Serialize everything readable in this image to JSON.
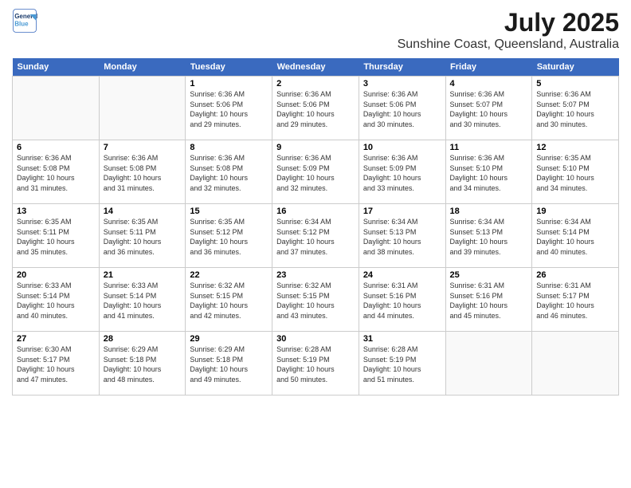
{
  "header": {
    "logo_line1": "General",
    "logo_line2": "Blue",
    "title": "July 2025",
    "subtitle": "Sunshine Coast, Queensland, Australia"
  },
  "days_of_week": [
    "Sunday",
    "Monday",
    "Tuesday",
    "Wednesday",
    "Thursday",
    "Friday",
    "Saturday"
  ],
  "weeks": [
    [
      {
        "num": "",
        "info": ""
      },
      {
        "num": "",
        "info": ""
      },
      {
        "num": "1",
        "info": "Sunrise: 6:36 AM\nSunset: 5:06 PM\nDaylight: 10 hours\nand 29 minutes."
      },
      {
        "num": "2",
        "info": "Sunrise: 6:36 AM\nSunset: 5:06 PM\nDaylight: 10 hours\nand 29 minutes."
      },
      {
        "num": "3",
        "info": "Sunrise: 6:36 AM\nSunset: 5:06 PM\nDaylight: 10 hours\nand 30 minutes."
      },
      {
        "num": "4",
        "info": "Sunrise: 6:36 AM\nSunset: 5:07 PM\nDaylight: 10 hours\nand 30 minutes."
      },
      {
        "num": "5",
        "info": "Sunrise: 6:36 AM\nSunset: 5:07 PM\nDaylight: 10 hours\nand 30 minutes."
      }
    ],
    [
      {
        "num": "6",
        "info": "Sunrise: 6:36 AM\nSunset: 5:08 PM\nDaylight: 10 hours\nand 31 minutes."
      },
      {
        "num": "7",
        "info": "Sunrise: 6:36 AM\nSunset: 5:08 PM\nDaylight: 10 hours\nand 31 minutes."
      },
      {
        "num": "8",
        "info": "Sunrise: 6:36 AM\nSunset: 5:08 PM\nDaylight: 10 hours\nand 32 minutes."
      },
      {
        "num": "9",
        "info": "Sunrise: 6:36 AM\nSunset: 5:09 PM\nDaylight: 10 hours\nand 32 minutes."
      },
      {
        "num": "10",
        "info": "Sunrise: 6:36 AM\nSunset: 5:09 PM\nDaylight: 10 hours\nand 33 minutes."
      },
      {
        "num": "11",
        "info": "Sunrise: 6:36 AM\nSunset: 5:10 PM\nDaylight: 10 hours\nand 34 minutes."
      },
      {
        "num": "12",
        "info": "Sunrise: 6:35 AM\nSunset: 5:10 PM\nDaylight: 10 hours\nand 34 minutes."
      }
    ],
    [
      {
        "num": "13",
        "info": "Sunrise: 6:35 AM\nSunset: 5:11 PM\nDaylight: 10 hours\nand 35 minutes."
      },
      {
        "num": "14",
        "info": "Sunrise: 6:35 AM\nSunset: 5:11 PM\nDaylight: 10 hours\nand 36 minutes."
      },
      {
        "num": "15",
        "info": "Sunrise: 6:35 AM\nSunset: 5:12 PM\nDaylight: 10 hours\nand 36 minutes."
      },
      {
        "num": "16",
        "info": "Sunrise: 6:34 AM\nSunset: 5:12 PM\nDaylight: 10 hours\nand 37 minutes."
      },
      {
        "num": "17",
        "info": "Sunrise: 6:34 AM\nSunset: 5:13 PM\nDaylight: 10 hours\nand 38 minutes."
      },
      {
        "num": "18",
        "info": "Sunrise: 6:34 AM\nSunset: 5:13 PM\nDaylight: 10 hours\nand 39 minutes."
      },
      {
        "num": "19",
        "info": "Sunrise: 6:34 AM\nSunset: 5:14 PM\nDaylight: 10 hours\nand 40 minutes."
      }
    ],
    [
      {
        "num": "20",
        "info": "Sunrise: 6:33 AM\nSunset: 5:14 PM\nDaylight: 10 hours\nand 40 minutes."
      },
      {
        "num": "21",
        "info": "Sunrise: 6:33 AM\nSunset: 5:14 PM\nDaylight: 10 hours\nand 41 minutes."
      },
      {
        "num": "22",
        "info": "Sunrise: 6:32 AM\nSunset: 5:15 PM\nDaylight: 10 hours\nand 42 minutes."
      },
      {
        "num": "23",
        "info": "Sunrise: 6:32 AM\nSunset: 5:15 PM\nDaylight: 10 hours\nand 43 minutes."
      },
      {
        "num": "24",
        "info": "Sunrise: 6:31 AM\nSunset: 5:16 PM\nDaylight: 10 hours\nand 44 minutes."
      },
      {
        "num": "25",
        "info": "Sunrise: 6:31 AM\nSunset: 5:16 PM\nDaylight: 10 hours\nand 45 minutes."
      },
      {
        "num": "26",
        "info": "Sunrise: 6:31 AM\nSunset: 5:17 PM\nDaylight: 10 hours\nand 46 minutes."
      }
    ],
    [
      {
        "num": "27",
        "info": "Sunrise: 6:30 AM\nSunset: 5:17 PM\nDaylight: 10 hours\nand 47 minutes."
      },
      {
        "num": "28",
        "info": "Sunrise: 6:29 AM\nSunset: 5:18 PM\nDaylight: 10 hours\nand 48 minutes."
      },
      {
        "num": "29",
        "info": "Sunrise: 6:29 AM\nSunset: 5:18 PM\nDaylight: 10 hours\nand 49 minutes."
      },
      {
        "num": "30",
        "info": "Sunrise: 6:28 AM\nSunset: 5:19 PM\nDaylight: 10 hours\nand 50 minutes."
      },
      {
        "num": "31",
        "info": "Sunrise: 6:28 AM\nSunset: 5:19 PM\nDaylight: 10 hours\nand 51 minutes."
      },
      {
        "num": "",
        "info": ""
      },
      {
        "num": "",
        "info": ""
      }
    ]
  ]
}
